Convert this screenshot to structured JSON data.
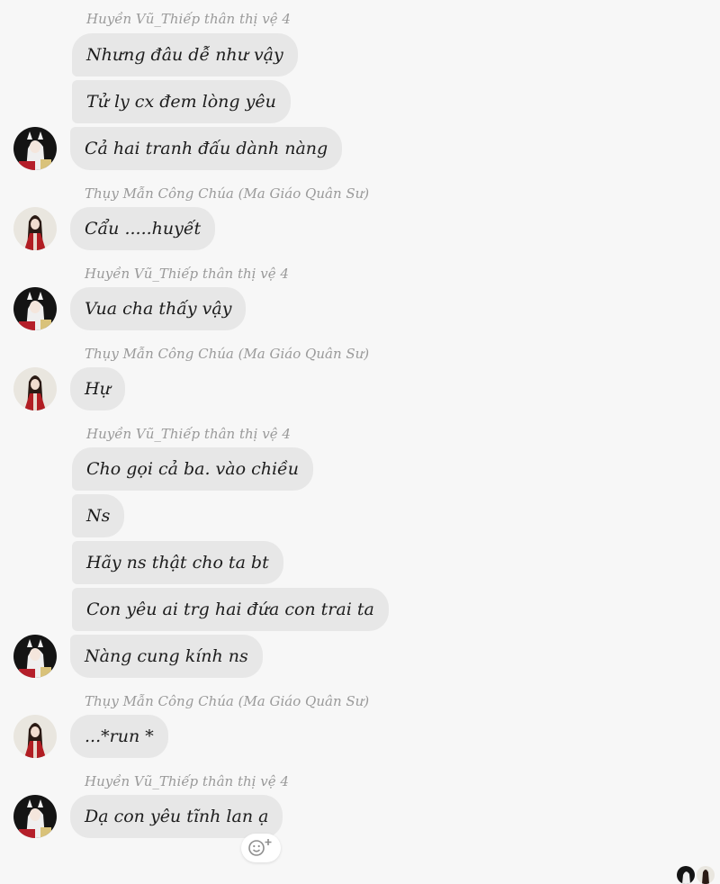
{
  "chat": {
    "senders": {
      "huyen": "Huyền Vũ_Thiếp thân thị vệ 4",
      "thuy": "Thụy Mẫn Công Chúa (Ma Giáo Quân Sư)"
    },
    "messages": [
      "Nhưng đâu dễ như vậy",
      "Tử ly cx đem lòng yêu",
      "Cả hai tranh đấu dành nàng",
      "Cẩu .....huyết",
      "Vua cha thấy vậy",
      "Hự",
      "Cho gọi cả ba. vào chiều",
      "Ns",
      "Hãy ns thật cho ta bt",
      "Con yêu ai  trg hai đứa con trai ta",
      "Nàng cung kính ns",
      "...*run *",
      "Dạ con yêu tĩnh lan ạ"
    ]
  },
  "avatars": {
    "huyen": "white-haired-character-avatar",
    "thuy": "red-robed-princess-avatar"
  },
  "reaction_button": {
    "icon": "smiley-add-icon"
  }
}
